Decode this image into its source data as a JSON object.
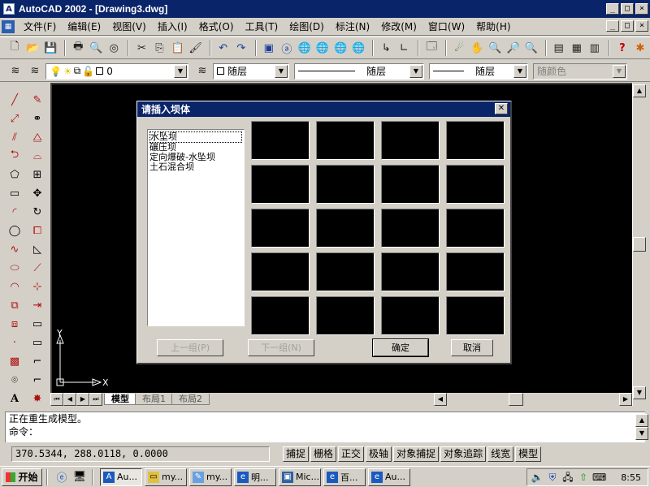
{
  "window": {
    "title": "AutoCAD 2002 - [Drawing3.dwg]",
    "caption_buttons": [
      "_",
      "□",
      "×"
    ]
  },
  "menu": {
    "items": [
      "文件(F)",
      "编辑(E)",
      "视图(V)",
      "插入(I)",
      "格式(O)",
      "工具(T)",
      "绘图(D)",
      "标注(N)",
      "修改(M)",
      "窗口(W)",
      "帮助(H)"
    ]
  },
  "layers": {
    "current_layer": "0",
    "color_combo": "随层",
    "linetype_combo": "随层",
    "lineweight_combo": "随层",
    "plotstyle_combo": "随颜色"
  },
  "tabs": {
    "model": "模型",
    "layout1": "布局1",
    "layout2": "布局2"
  },
  "ucs": {
    "x_label": "X",
    "y_label": "Y"
  },
  "dialog": {
    "title": "请插入坝体",
    "list_items": [
      "水坠坝",
      "碾压坝",
      "定向爆破-水坠坝",
      "土石混合坝"
    ],
    "selected_index": 0,
    "prev_button": "上一组(P)",
    "next_button": "下一组(N)",
    "ok_button": "确定",
    "cancel_button": "取消"
  },
  "command": {
    "line1": "正在重生成模型。",
    "line2": "命令："
  },
  "status": {
    "coordinates": "370.5344, 288.0118, 0.0000",
    "buttons": [
      "捕捉",
      "栅格",
      "正交",
      "极轴",
      "对象捕捉",
      "对象追踪",
      "线宽",
      "模型"
    ]
  },
  "taskbar": {
    "start_label": "开始",
    "tasks": [
      "Au...",
      "my...",
      "my...",
      "明...",
      "Mic...",
      "百...",
      "Au..."
    ],
    "clock": "8:55"
  }
}
